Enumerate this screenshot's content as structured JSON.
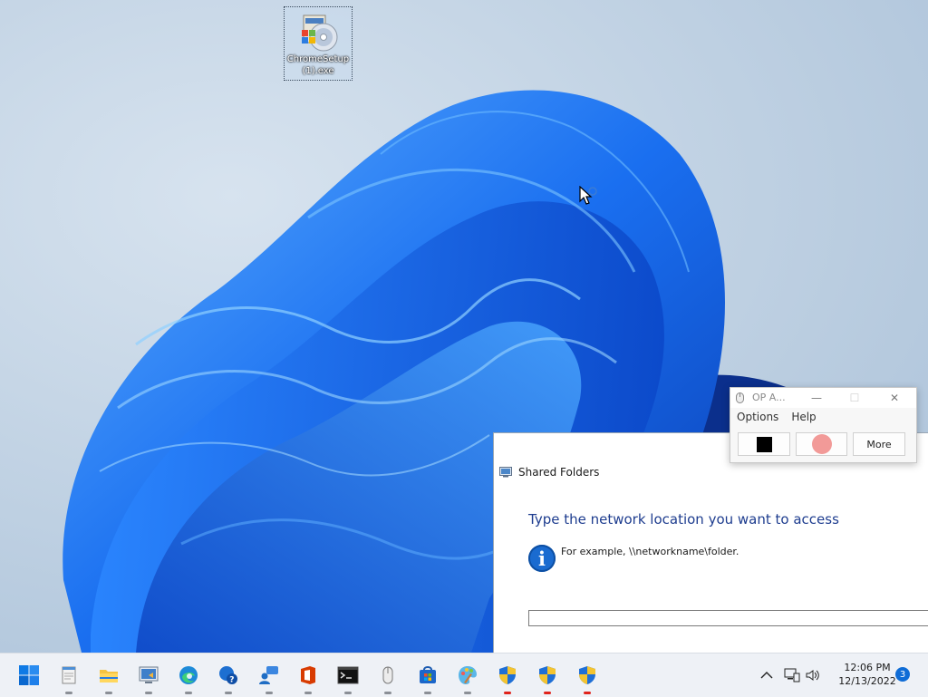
{
  "desktop": {
    "icon_label": "ChromeSetup (1).exe"
  },
  "wizard": {
    "title": "Shared Folders",
    "heading": "Type the network location you want to access",
    "info_text": "For example, \\\\networkname\\folder.",
    "path_value": ""
  },
  "op_clicker": {
    "title": "OP A...",
    "menu": [
      "Options",
      "Help"
    ],
    "more_label": "More"
  },
  "taskbar": {
    "apps": [
      {
        "name": "start-icon",
        "indicator": "none"
      },
      {
        "name": "notepad-icon",
        "indicator": "gray"
      },
      {
        "name": "file-explorer-icon",
        "indicator": "gray"
      },
      {
        "name": "remote-desktop-icon",
        "indicator": "gray"
      },
      {
        "name": "edge-icon",
        "indicator": "gray"
      },
      {
        "name": "get-help-icon",
        "indicator": "gray"
      },
      {
        "name": "people-icon",
        "indicator": "gray"
      },
      {
        "name": "office-icon",
        "indicator": "gray"
      },
      {
        "name": "terminal-icon",
        "indicator": "gray"
      },
      {
        "name": "mouse-icon",
        "indicator": "gray"
      },
      {
        "name": "store-icon",
        "indicator": "gray"
      },
      {
        "name": "paint-icon",
        "indicator": "gray"
      },
      {
        "name": "security-shield-icon",
        "indicator": "red"
      },
      {
        "name": "security-shield-icon",
        "indicator": "red"
      },
      {
        "name": "security-shield-icon",
        "indicator": "red"
      }
    ],
    "clock_time": "12:06 PM",
    "clock_date": "12/13/2022",
    "notification_count": "3"
  },
  "colors": {
    "accent": "#0f6cd6",
    "bloom_blue": "#1a6ff0",
    "heading_blue": "#1e3d8f",
    "indicator_red": "#e0231b"
  }
}
